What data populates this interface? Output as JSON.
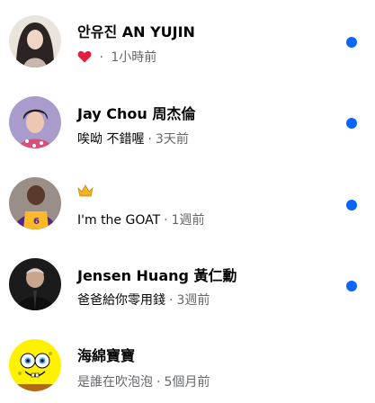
{
  "conversations": [
    {
      "name": "안유진 AN YUJIN",
      "message": "",
      "message_icon": "heart-icon",
      "separator": "·",
      "time": "1小時前",
      "unread": true
    },
    {
      "name": "Jay Chou 周杰倫",
      "message": "唉呦 不錯喔",
      "separator": "·",
      "time": "3天前",
      "unread": true
    },
    {
      "name": "",
      "name_icon": "crown-icon",
      "message": "I'm the GOAT",
      "separator": "·",
      "time": "1週前",
      "unread": true
    },
    {
      "name": "Jensen Huang 黃仁勳",
      "message": "爸爸給你零用錢",
      "separator": "·",
      "time": "3週前",
      "unread": true
    },
    {
      "name": "海綿寶寶",
      "message": "是誰在吹泡泡",
      "separator": "·",
      "time": "5個月前",
      "unread": false
    }
  ],
  "colors": {
    "unread_dot": "#0866ff",
    "heart": "#e41e3f",
    "crown": "#f0b429",
    "secondary_text": "#65676b",
    "primary_text": "#050505"
  }
}
